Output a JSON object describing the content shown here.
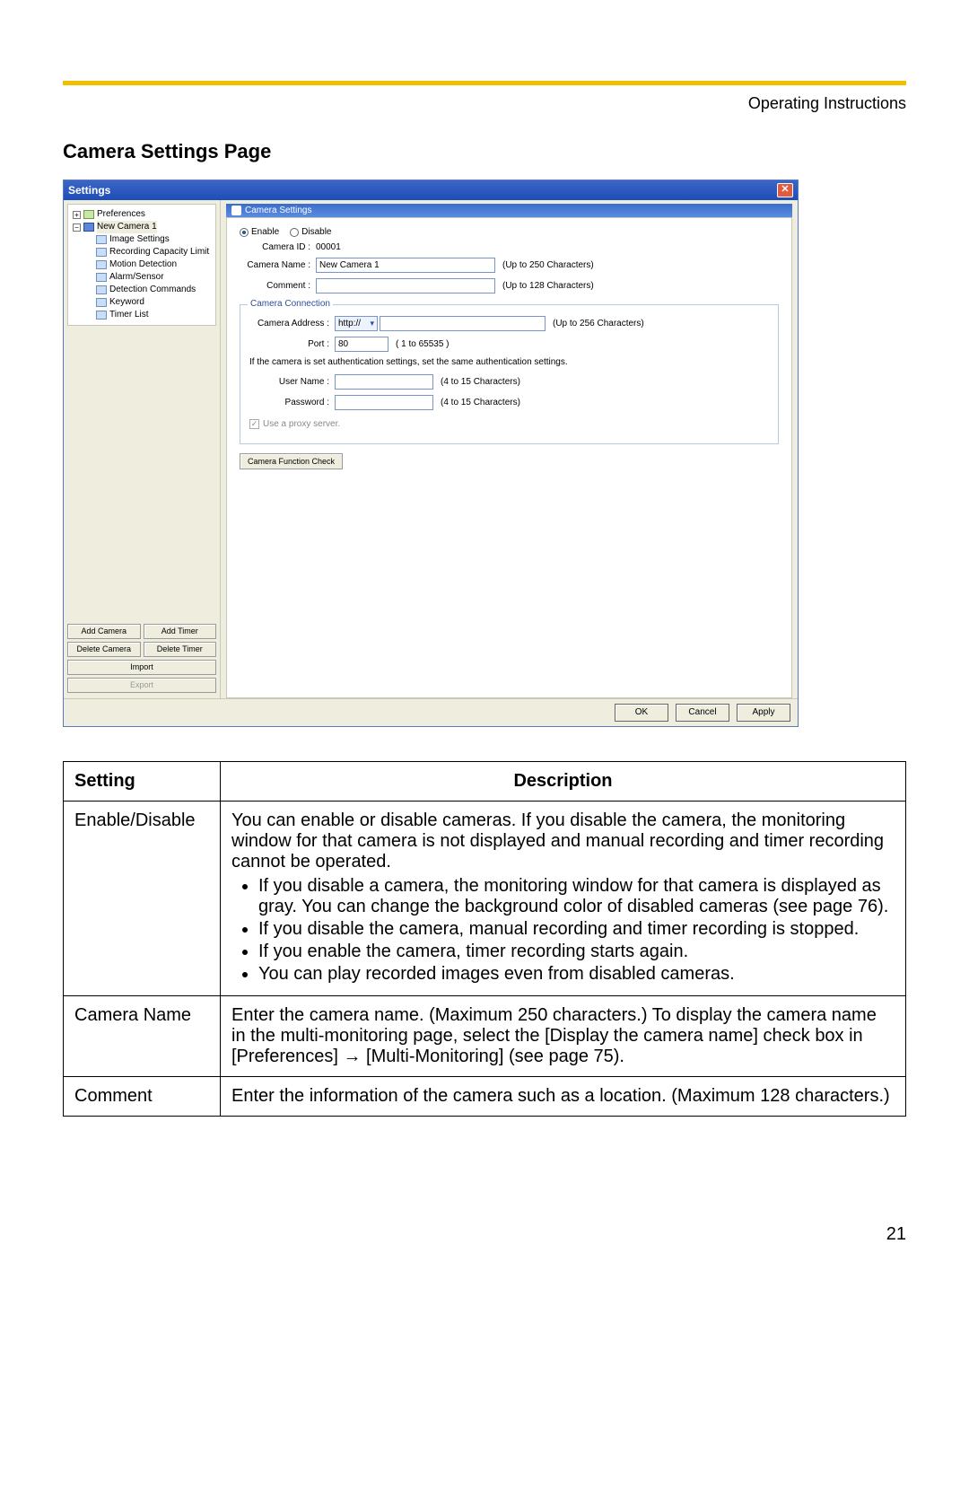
{
  "header": {
    "doc_title": "Operating Instructions"
  },
  "section": {
    "title": "Camera Settings Page"
  },
  "window": {
    "title": "Settings",
    "tree": {
      "preferences": "Preferences",
      "camera_node": "New Camera 1",
      "items": [
        "Image Settings",
        "Recording Capacity Limit",
        "Motion Detection",
        "Alarm/Sensor",
        "Detection Commands",
        "Keyword",
        "Timer List"
      ]
    },
    "side_buttons": {
      "add_camera": "Add Camera",
      "add_timer": "Add Timer",
      "delete_camera": "Delete Camera",
      "delete_timer": "Delete Timer",
      "import": "Import",
      "export": "Export"
    },
    "panel": {
      "title": "Camera Settings",
      "enable": "Enable",
      "disable": "Disable",
      "camera_id_label": "Camera ID :",
      "camera_id_value": "00001",
      "camera_name_label": "Camera Name :",
      "camera_name_value": "New Camera 1",
      "camera_name_hint": "(Up to 250 Characters)",
      "comment_label": "Comment :",
      "comment_value": "",
      "comment_hint": "(Up to 128 Characters)",
      "connection": {
        "group_title": "Camera Connection",
        "address_label": "Camera Address :",
        "protocol": "http://",
        "address_value": "",
        "address_hint": "(Up to 256 Characters)",
        "port_label": "Port :",
        "port_value": "80",
        "port_hint": "( 1 to 65535 )",
        "auth_note": "If the camera is set authentication settings, set the same authentication settings.",
        "user_label": "User Name :",
        "user_value": "",
        "user_hint": "(4 to 15 Characters)",
        "pass_label": "Password :",
        "pass_value": "",
        "pass_hint": "(4 to 15 Characters)",
        "proxy_label": "Use a proxy server."
      },
      "func_check": "Camera Function Check"
    },
    "footer": {
      "ok": "OK",
      "cancel": "Cancel",
      "apply": "Apply"
    }
  },
  "table": {
    "head_setting": "Setting",
    "head_description": "Description",
    "rows": [
      {
        "setting": "Enable/Disable",
        "desc_intro": "You can enable or disable cameras. If you disable the camera, the monitoring window for that camera is not displayed and manual recording and timer recording cannot be operated.",
        "bullets": [
          "If you disable a camera, the monitoring window for that camera is displayed as gray. You can change the background color of disabled cameras (see page 76).",
          "If you disable the camera, manual recording and timer recording is stopped.",
          "If you enable the camera, timer recording starts again.",
          "You can play recorded images even from disabled cameras."
        ]
      },
      {
        "setting": "Camera Name",
        "desc_intro": "Enter the camera name. (Maximum 250 characters.) To display the camera name in the multi-monitoring page, select the [Display the camera name] check box in [Preferences] → [Multi-Monitoring] (see page 75)."
      },
      {
        "setting": "Comment",
        "desc_intro": "Enter the information of the camera such as a location. (Maximum 128 characters.)"
      }
    ]
  },
  "page_number": "21"
}
